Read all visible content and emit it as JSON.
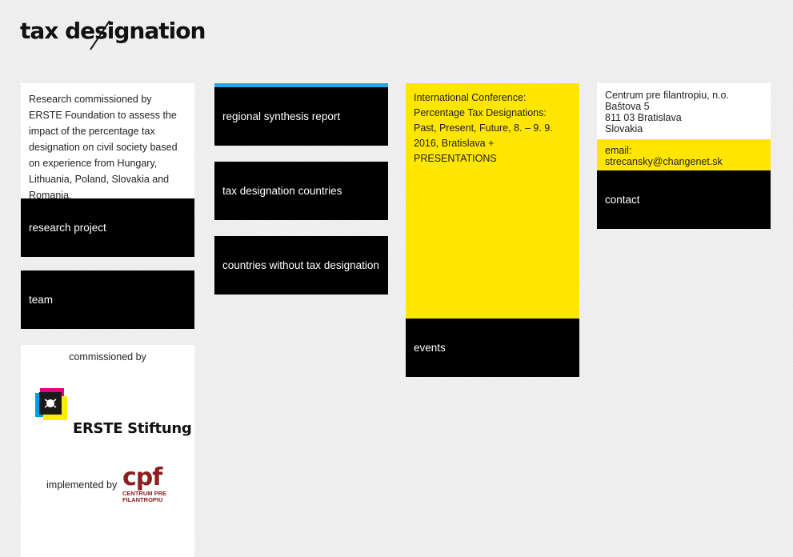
{
  "logo": {
    "text": "tax designation"
  },
  "column1": {
    "intro": "Research commissioned by ERSTE Foundation to assess the impact of the percentage tax designation on civil society based on experience from Hungary, Lithuania, Poland, Slovakia and Romania.",
    "research_project": "research project",
    "team": "team",
    "commissioned_by": "commissioned by",
    "erste_name": "ERSTE Stiftung",
    "implemented_by": "implemented by",
    "cpf_big": "cpf",
    "cpf_small1": "CENTRUM PRE",
    "cpf_small2": "FILANTROPIU"
  },
  "column2": {
    "items": [
      "regional synthesis report",
      "tax designation countries",
      "countries without tax designation"
    ]
  },
  "column3": {
    "conference": "International Conference: Percentage Tax Designations: Past, Present, Future, 8. – 9. 9. 2016, Bratislava + PRESENTATIONS",
    "events": "events"
  },
  "column4": {
    "org": "Centrum pre filantropiu, n.o.",
    "street": "Baštova 5",
    "city": "811 03 Bratislava",
    "country": "Slovakia",
    "email_label": "email:",
    "email": "strecansky@changenet.sk",
    "contact": "contact"
  },
  "colors": {
    "yellow": "#ffe600",
    "black": "#000000",
    "accent": "#2aa6dc",
    "cpf_red": "#8b1e1e"
  }
}
